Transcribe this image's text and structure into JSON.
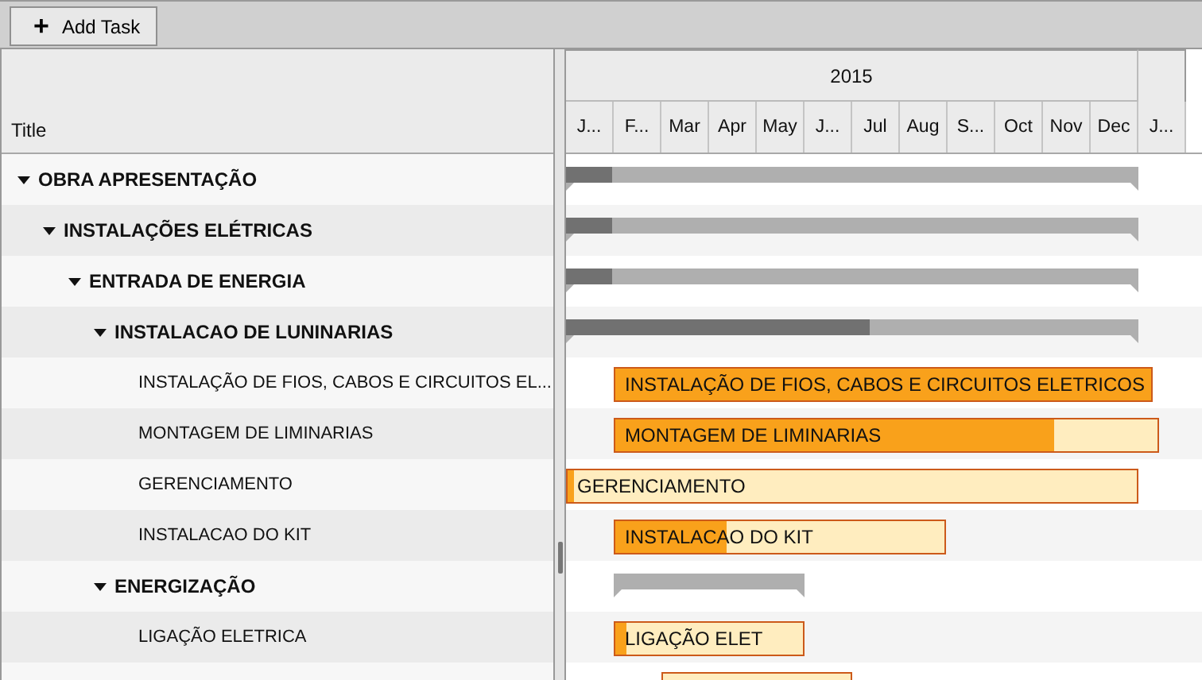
{
  "toolbar": {
    "add_task_button": {
      "icon": "+",
      "label": "Add Task"
    }
  },
  "grid": {
    "column_title": "Title"
  },
  "timeline": {
    "year": "2015",
    "months": [
      "J...",
      "F...",
      "Mar",
      "Apr",
      "May",
      "J...",
      "Jul",
      "Aug",
      "S...",
      "Oct",
      "Nov",
      "Dec",
      "J..."
    ]
  },
  "tasks": [
    {
      "kind": "summary",
      "title": "OBRA APRESENTAÇÃO",
      "expanded": true,
      "level": 0.08,
      "children": [
        {
          "kind": "summary",
          "title": "INSTALAÇÕES ELÉTRICAS",
          "expanded": true,
          "level": 0.08,
          "children": [
            {
              "kind": "summary",
              "title": "ENTRADA DE ENERGIA",
              "expanded": true,
              "level": 0.08,
              "children": [
                {
                  "kind": "summary",
                  "title": "INSTALACAO DE LUNINARIAS",
                  "expanded": true,
                  "level": 0.53,
                  "children": [
                    {
                      "kind": "task",
                      "title": "INSTALAÇÃO DE FIOS, CABOS E CIRCUITOS EL...",
                      "bar_label": "INSTALAÇÃO DE FIOS, CABOS E CIRCUITOS ELETRICOS",
                      "level": 1
                    },
                    {
                      "kind": "task",
                      "title": "MONTAGEM DE LIMINARIAS",
                      "bar_label": "MONTAGEM DE LIMINARIAS",
                      "level": 0.81
                    },
                    {
                      "kind": "task",
                      "title": "GERENCIAMENTO",
                      "bar_label": "GERENCIAMENTO",
                      "level": 0.01
                    },
                    {
                      "kind": "task",
                      "title": "INSTALACAO DO KIT",
                      "bar_label": "INSTALACAO DO KIT",
                      "level": 0.34
                    }
                  ]
                },
                {
                  "kind": "summary",
                  "title": "ENERGIZAÇÃO",
                  "expanded": true,
                  "children": [
                    {
                      "kind": "task",
                      "title": "LIGAÇÃO ELETRICA",
                      "bar_label": "LIGAÇÃO ELET",
                      "level": 0.06
                    },
                    {
                      "kind": "task"
                    }
                  ]
                }
              ]
            }
          ]
        }
      ]
    }
  ]
}
